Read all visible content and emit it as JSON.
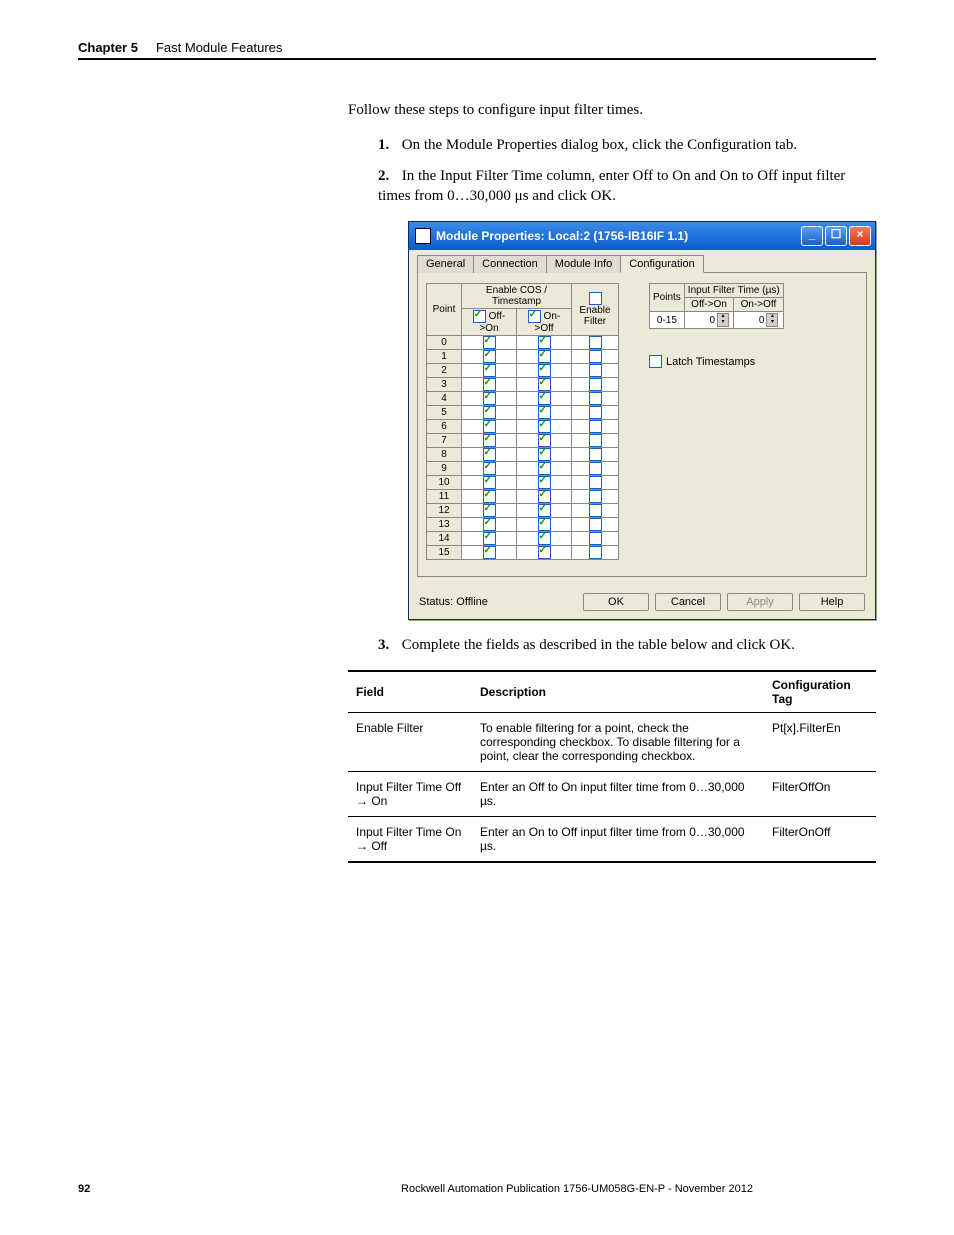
{
  "header": {
    "chapter": "Chapter 5",
    "title": "Fast Module Features"
  },
  "intro": "Follow these steps to configure input filter times.",
  "steps": {
    "s1_num": "1.",
    "s1": "On the Module Properties dialog box, click the Configuration tab.",
    "s2_num": "2.",
    "s2": "In the Input Filter Time column, enter Off to On and On to Off input filter times from 0…30,000 μs and click OK.",
    "s3_num": "3.",
    "s3": "Complete the fields as described in the table below and click OK."
  },
  "dialog": {
    "title": "Module Properties: Local:2 (1756-IB16IF 1.1)",
    "tabs": {
      "t1": "General",
      "t2": "Connection",
      "t3": "Module Info",
      "t4": "Configuration"
    },
    "left_headers": {
      "point": "Point",
      "cos_group": "Enable COS / Timestamp",
      "off_on": "Off->On",
      "on_off": "On->Off",
      "enable_filter": "Enable Filter"
    },
    "right_headers": {
      "points": "Points",
      "ift": "Input Filter Time (µs)",
      "off_on": "Off->On",
      "on_off": "On->Off",
      "range": "0-15",
      "val1": "0",
      "val2": "0"
    },
    "latch": "Latch Timestamps",
    "points": [
      "0",
      "1",
      "2",
      "3",
      "4",
      "5",
      "6",
      "7",
      "8",
      "9",
      "10",
      "11",
      "12",
      "13",
      "14",
      "15"
    ],
    "status_label": "Status: Offline",
    "buttons": {
      "ok": "OK",
      "cancel": "Cancel",
      "apply": "Apply",
      "help": "Help"
    }
  },
  "fields_table": {
    "h1": "Field",
    "h2": "Description",
    "h3": "Configuration Tag",
    "r1": {
      "f": "Enable Filter",
      "d": "To enable filtering for a point, check the corresponding checkbox. To disable filtering for a point, clear the corresponding checkbox.",
      "t": "Pt[x].FilterEn"
    },
    "r2": {
      "f": "Input Filter Time Off → On",
      "d": "Enter an Off to On input filter time from 0…30,000 µs.",
      "t": "FilterOffOn"
    },
    "r3": {
      "f": "Input Filter Time On → Off",
      "d": "Enter an On to Off input filter time from 0…30,000 µs.",
      "t": "FilterOnOff"
    }
  },
  "footer": {
    "page": "92",
    "pub": "Rockwell Automation Publication 1756-UM058G-EN-P - November 2012"
  }
}
